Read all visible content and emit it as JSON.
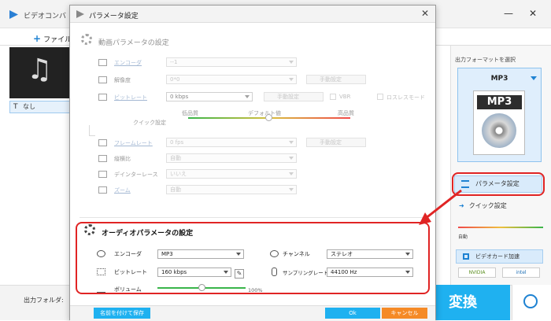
{
  "app": {
    "title": "ビデオコンバ",
    "toolbar_add_file": "ファイル",
    "subtitle_value": "なし",
    "output_folder_label": "出力フォルダ:",
    "convert_label": "変換"
  },
  "right_panel": {
    "format_label": "出力フォーマットを選択",
    "format_name": "MP3",
    "format_icon_text": "MP3",
    "param_button": "パラメータ設定",
    "quick_button": "クイック設定",
    "quick_auto": "自動",
    "hw_accel": "ビデオカード加速",
    "vendor_nvidia": "NVIDIA",
    "vendor_intel": "intel"
  },
  "dialog": {
    "title": "パラメータ設定",
    "video_section": {
      "heading": "動画パラメータの設定",
      "encoder": {
        "label": "エンコーダ",
        "value": "--1"
      },
      "resolution": {
        "label": "解像度",
        "value": "0*0",
        "manual": "手動設定"
      },
      "bitrate": {
        "label": "ビットレート",
        "value": "0 kbps",
        "manual": "手動設定",
        "vbr": "VBR",
        "lossless": "ロスレスモード"
      },
      "quick": {
        "label": "クイック設定",
        "low": "低品質",
        "default": "デフォルト値",
        "high": "高品質"
      },
      "framerate": {
        "label": "フレームレート",
        "value": "0 fps",
        "manual": "手動設定"
      },
      "aspect": {
        "label": "縦横比",
        "value": "自動"
      },
      "deinterlace": {
        "label": "デインターレース",
        "value": "いいえ"
      },
      "zoom": {
        "label": "ズーム",
        "value": "自動"
      }
    },
    "audio_section": {
      "heading": "オーディオパラメータの設定",
      "encoder": {
        "label": "エンコーダ",
        "value": "MP3"
      },
      "channel": {
        "label": "チャンネル",
        "value": "ステレオ"
      },
      "bitrate": {
        "label": "ビットレート",
        "value": "160 kbps"
      },
      "sample_rate": {
        "label": "サンプリングレート",
        "value": "44100 Hz"
      },
      "volume": {
        "label": "ボリューム",
        "value": "100%",
        "level": 0.5
      }
    },
    "footer": {
      "save_as": "名前を付けて保存",
      "ok": "Ok",
      "cancel": "キャンセル"
    }
  },
  "colors": {
    "accent": "#1fb1f0",
    "cancel": "#f58a26",
    "annotation": "#e02424"
  }
}
